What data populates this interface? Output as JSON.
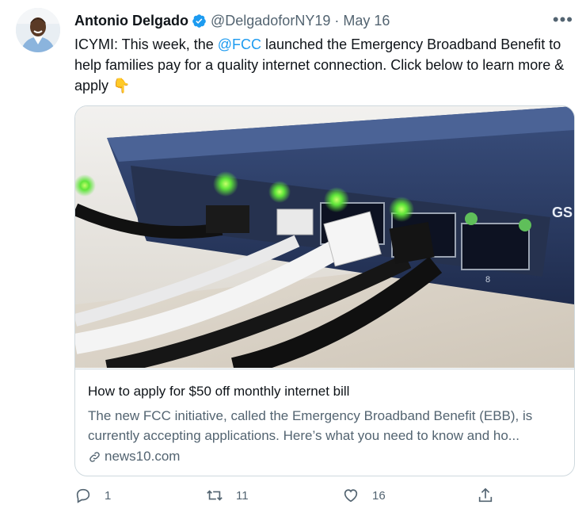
{
  "tweet": {
    "author_name": "Antonio Delgado",
    "handle": "@DelgadoforNY19",
    "separator": "·",
    "date": "May 16",
    "more_label": "•••",
    "text_before": "ICYMI: This week, the ",
    "mention": "@FCC",
    "text_after": " launched the Emergency Broadband Benefit to help families pay for a quality internet connection. Click below to learn more & apply 👇"
  },
  "card": {
    "title": "How to apply for $50 off monthly internet bill",
    "description": "The new FCC initiative, called the Emergency Broadband Benefit (EBB), is currently accepting applications. Here’s what you need to know and ho...",
    "domain": "news10.com",
    "image_device_label": "GS",
    "image_port_label": "8"
  },
  "actions": {
    "replies": "1",
    "retweets": "11",
    "likes": "16"
  },
  "colors": {
    "accent": "#1d9bf0",
    "secondary_text": "#536471",
    "border": "#cfd9de"
  },
  "icons": [
    "verified-badge-icon",
    "more-icon",
    "link-icon",
    "reply-icon",
    "retweet-icon",
    "like-icon",
    "share-icon"
  ]
}
